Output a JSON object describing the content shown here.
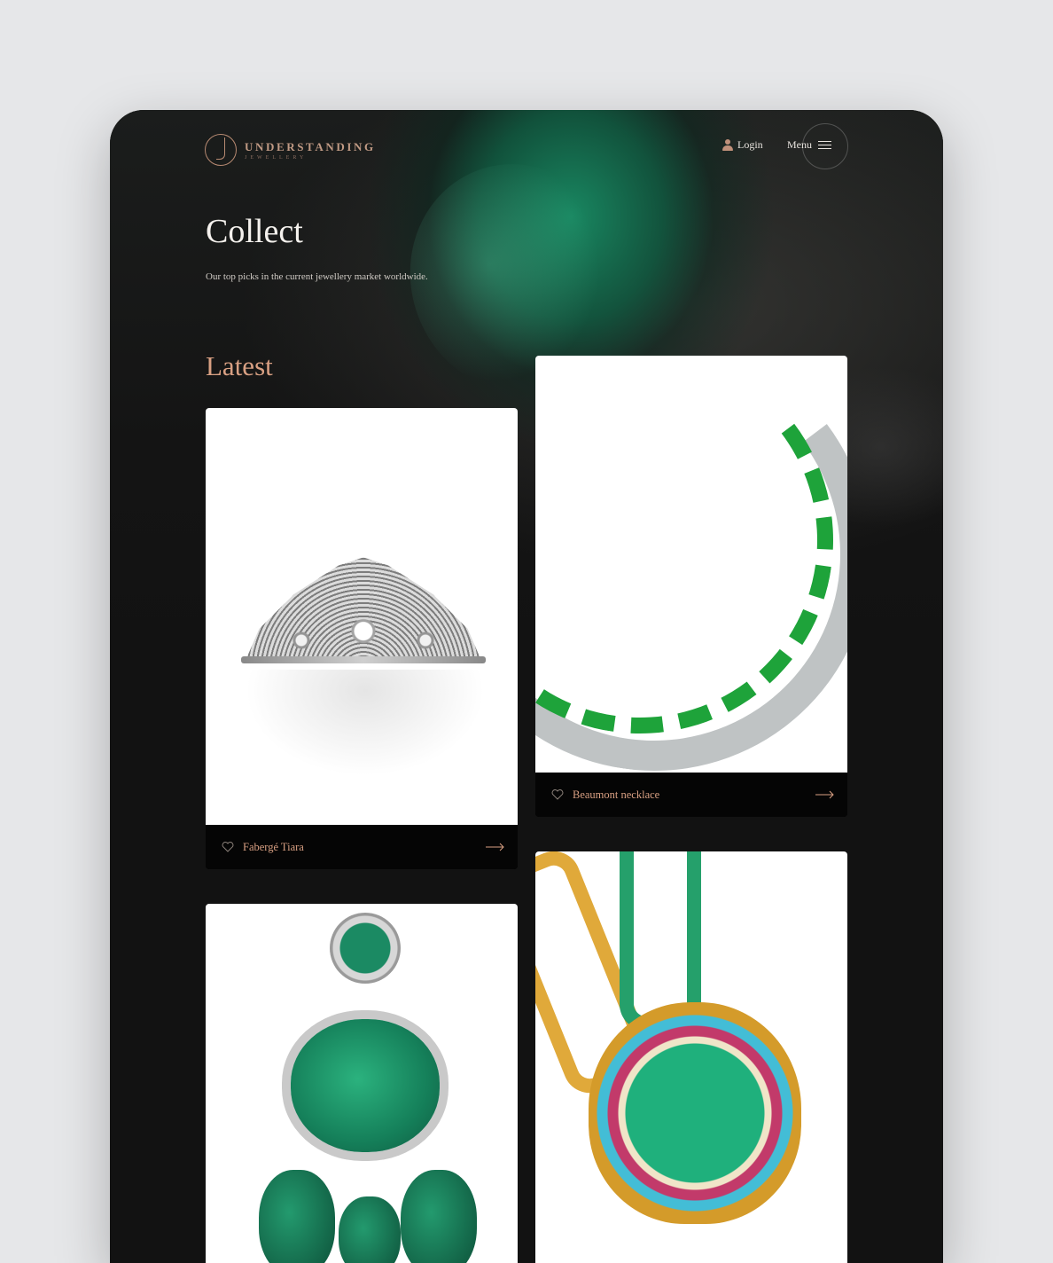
{
  "brand": {
    "title": "UNDERSTANDING",
    "subtitle": "JEWELLERY"
  },
  "nav": {
    "login_label": "Login",
    "menu_label": "Menu"
  },
  "hero": {
    "title": "Collect",
    "subtitle": "Our top picks in the current jewellery market worldwide."
  },
  "section": {
    "title": "Latest"
  },
  "cards": [
    {
      "name": "Fabergé Tiara"
    },
    {
      "name": "Beaumont necklace"
    },
    {
      "name": ""
    },
    {
      "name": ""
    }
  ],
  "colors": {
    "accent": "#d9a083",
    "background": "#121212",
    "card_bar": "#050505"
  }
}
